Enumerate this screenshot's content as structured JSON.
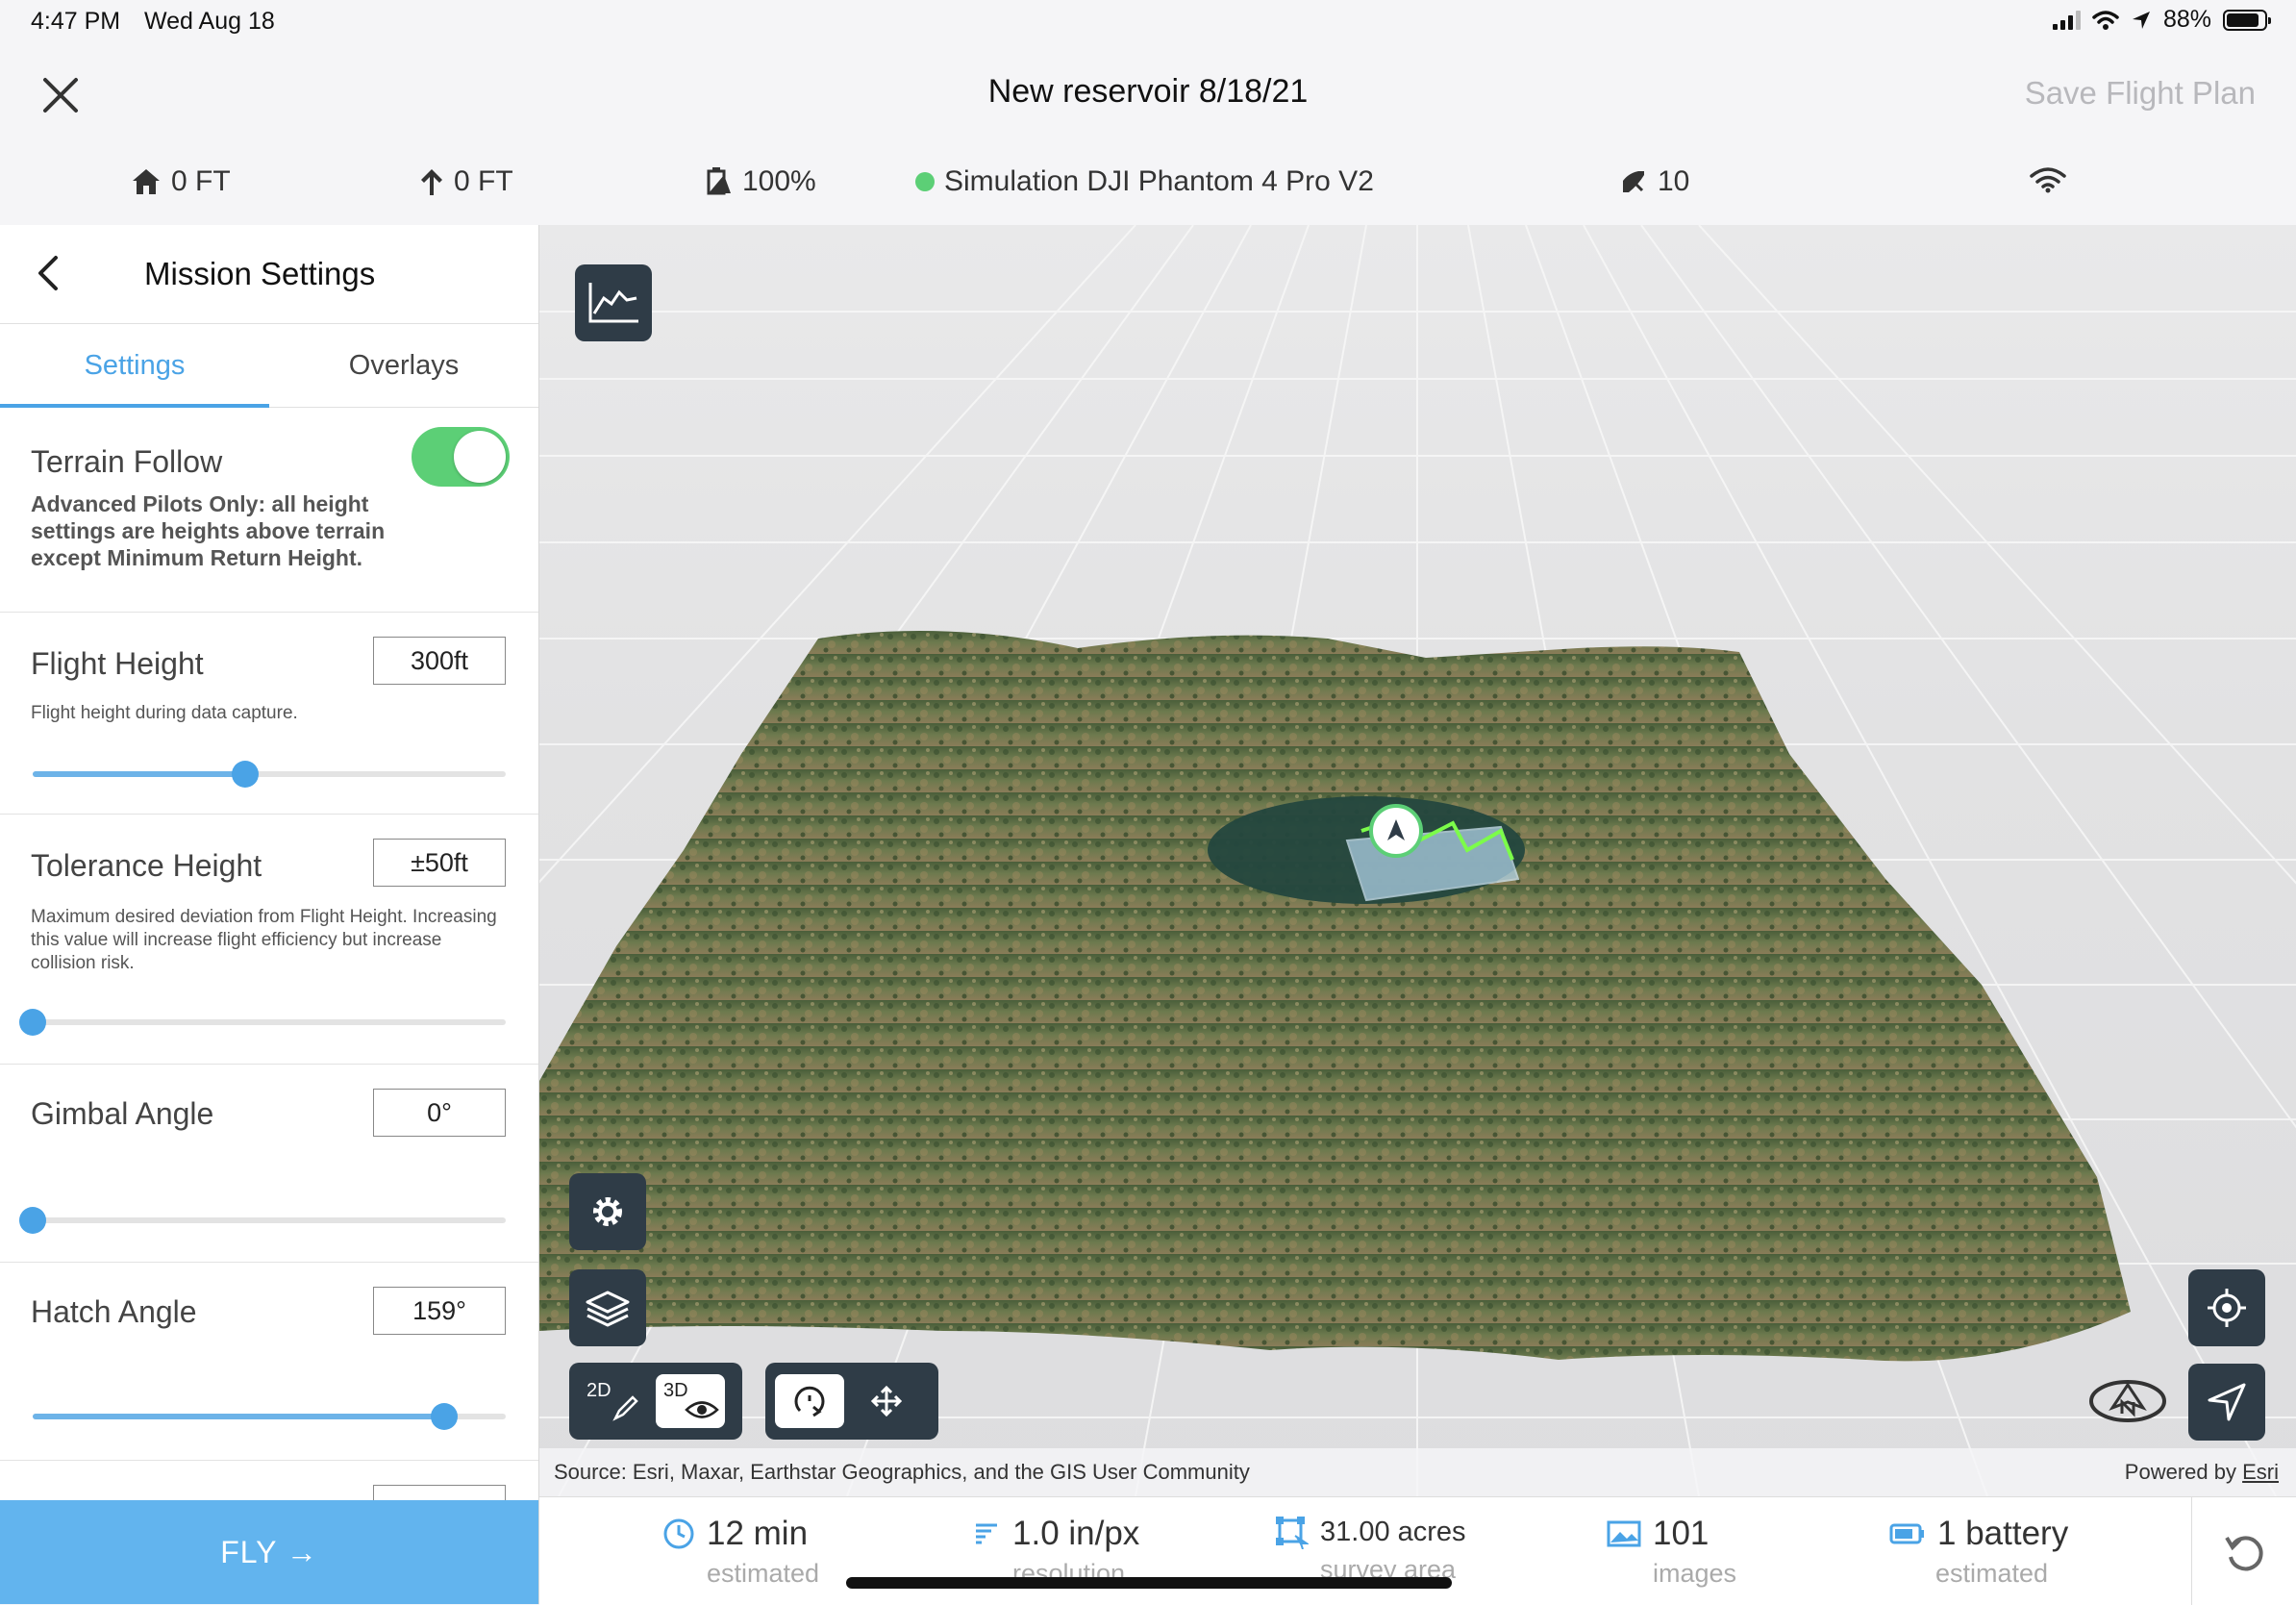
{
  "status_bar": {
    "time": "4:47 PM",
    "date": "Wed Aug 18",
    "battery_percent": "88%",
    "battery_level": 0.88
  },
  "header": {
    "title": "New reservoir 8/18/21",
    "save_label": "Save Flight Plan",
    "close_icon": "close-icon"
  },
  "telemetry": {
    "home_altitude": "0 FT",
    "altitude": "0 FT",
    "aircraft_battery": "100%",
    "aircraft": "Simulation DJI Phantom 4 Pro V2",
    "satellites": "10",
    "status_color": "#5ccf76"
  },
  "panel": {
    "title": "Mission Settings",
    "tabs": [
      {
        "label": "Settings",
        "active": true
      },
      {
        "label": "Overlays",
        "active": false
      }
    ],
    "terrain_follow": {
      "label": "Terrain Follow",
      "enabled": true,
      "description": "Advanced Pilots Only: all height settings are heights above terrain except Minimum Return Height."
    },
    "flight_height": {
      "label": "Flight Height",
      "value": "300ft",
      "description": "Flight height during data capture.",
      "slider_fraction": 0.45
    },
    "tolerance_height": {
      "label": "Tolerance Height",
      "value": "±50ft",
      "description": "Maximum desired deviation from Flight Height. Increasing this value will increase flight efficiency but increase collision risk.",
      "slider_fraction": 0.0
    },
    "gimbal_angle": {
      "label": "Gimbal Angle",
      "value": "0°",
      "slider_fraction": 0.0
    },
    "hatch_angle": {
      "label": "Hatch Angle",
      "value": "159°",
      "slider_fraction": 0.87
    },
    "fly_label": "FLY →"
  },
  "map": {
    "view_2d_label": "2D",
    "view_3d_label": "3D",
    "source_text": "Source: Esri, Maxar, Earthstar Geographics, and the GIS User Community",
    "powered_by": "Powered by",
    "powered_by_link": "Esri",
    "accent": "#2f3c47",
    "flight_path_color": "#7cfc4a"
  },
  "stats": {
    "time": {
      "value": "12 min",
      "sub": "estimated"
    },
    "resolution": {
      "value": "1.0 in/px",
      "sub": "resolution"
    },
    "area": {
      "value": "31.00 acres",
      "sub": "survey area"
    },
    "images": {
      "value": "101",
      "sub": "images"
    },
    "battery": {
      "value": "1 battery",
      "sub": "estimated"
    },
    "icon_color": "#4aa3e6"
  }
}
